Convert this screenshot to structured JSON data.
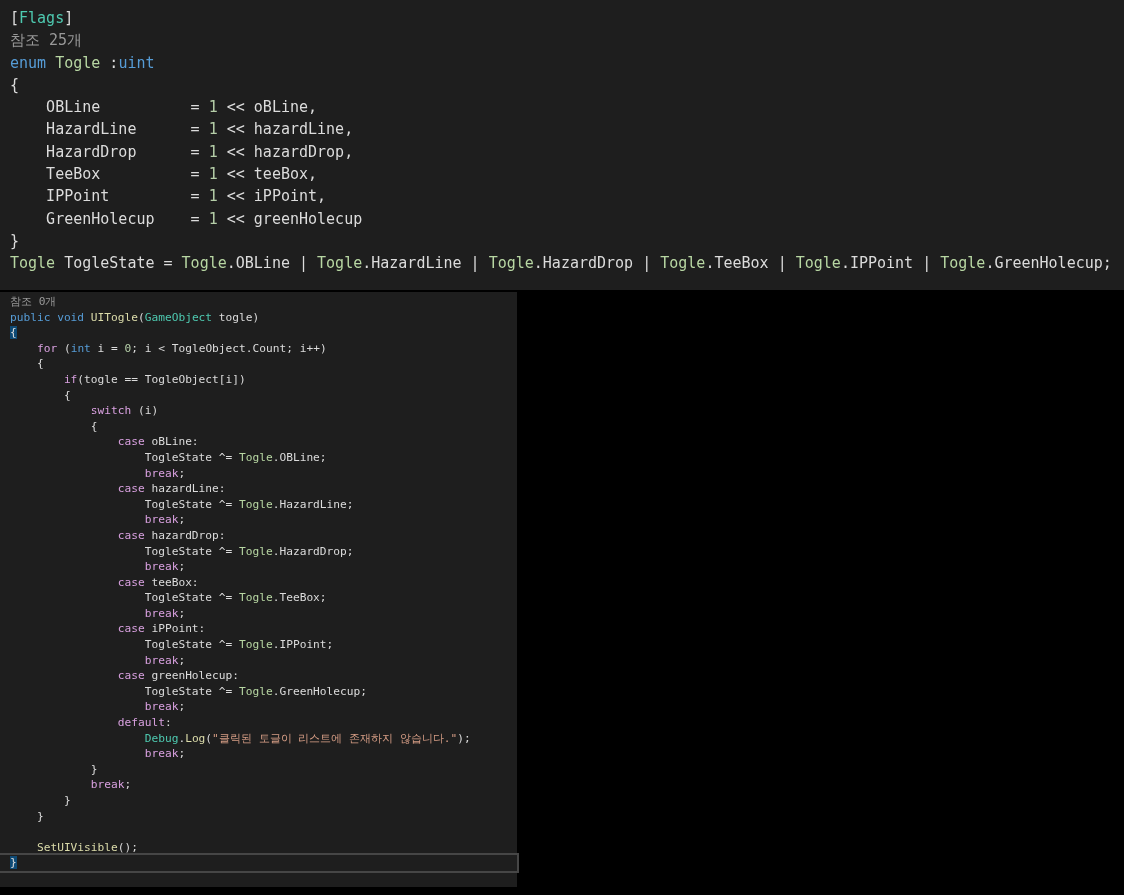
{
  "panels": [
    {
      "kind": "large",
      "lines": [
        {
          "current": false,
          "tokens": [
            {
              "kind": "plain",
              "text": "["
            },
            {
              "kind": "type",
              "text": "Flags"
            },
            {
              "kind": "plain",
              "text": "]"
            }
          ]
        },
        {
          "current": false,
          "tokens": [
            {
              "kind": "lens",
              "text": "참조 25개"
            }
          ]
        },
        {
          "current": false,
          "tokens": [
            {
              "kind": "keyword",
              "text": "enum "
            },
            {
              "kind": "enumtype",
              "text": "Togle"
            },
            {
              "kind": "plain",
              "text": " :"
            },
            {
              "kind": "keyword",
              "text": "uint"
            }
          ]
        },
        {
          "current": false,
          "tokens": [
            {
              "kind": "plain",
              "text": "{"
            }
          ]
        },
        {
          "current": false,
          "tokens": [
            {
              "kind": "plain",
              "text": "    OBLine          = "
            },
            {
              "kind": "number",
              "text": "1"
            },
            {
              "kind": "plain",
              "text": " << oBLine,"
            }
          ]
        },
        {
          "current": false,
          "tokens": [
            {
              "kind": "plain",
              "text": "    HazardLine      = "
            },
            {
              "kind": "number",
              "text": "1"
            },
            {
              "kind": "plain",
              "text": " << hazardLine,"
            }
          ]
        },
        {
          "current": false,
          "tokens": [
            {
              "kind": "plain",
              "text": "    HazardDrop      = "
            },
            {
              "kind": "number",
              "text": "1"
            },
            {
              "kind": "plain",
              "text": " << hazardDrop,"
            }
          ]
        },
        {
          "current": false,
          "tokens": [
            {
              "kind": "plain",
              "text": "    TeeBox          = "
            },
            {
              "kind": "number",
              "text": "1"
            },
            {
              "kind": "plain",
              "text": " << teeBox,"
            }
          ]
        },
        {
          "current": false,
          "tokens": [
            {
              "kind": "plain",
              "text": "    IPPoint         = "
            },
            {
              "kind": "number",
              "text": "1"
            },
            {
              "kind": "plain",
              "text": " << iPPoint,"
            }
          ]
        },
        {
          "current": false,
          "tokens": [
            {
              "kind": "plain",
              "text": "    GreenHolecup    = "
            },
            {
              "kind": "number",
              "text": "1"
            },
            {
              "kind": "plain",
              "text": " << greenHolecup"
            }
          ]
        },
        {
          "current": false,
          "tokens": [
            {
              "kind": "plain",
              "text": "}"
            }
          ]
        },
        {
          "current": false,
          "tokens": [
            {
              "kind": "enumtype",
              "text": "Togle"
            },
            {
              "kind": "plain",
              "text": " TogleState = "
            },
            {
              "kind": "enumtype",
              "text": "Togle"
            },
            {
              "kind": "plain",
              "text": ".OBLine | "
            },
            {
              "kind": "enumtype",
              "text": "Togle"
            },
            {
              "kind": "plain",
              "text": ".HazardLine | "
            },
            {
              "kind": "enumtype",
              "text": "Togle"
            },
            {
              "kind": "plain",
              "text": ".HazardDrop | "
            },
            {
              "kind": "enumtype",
              "text": "Togle"
            },
            {
              "kind": "plain",
              "text": ".TeeBox | "
            },
            {
              "kind": "enumtype",
              "text": "Togle"
            },
            {
              "kind": "plain",
              "text": ".IPPoint | "
            },
            {
              "kind": "enumtype",
              "text": "Togle"
            },
            {
              "kind": "plain",
              "text": ".GreenHolecup;"
            }
          ]
        }
      ]
    },
    {
      "kind": "small",
      "lines": [
        {
          "current": false,
          "tokens": [
            {
              "kind": "lens",
              "text": "참조 0개"
            }
          ]
        },
        {
          "current": false,
          "tokens": [
            {
              "kind": "keyword",
              "text": "public void "
            },
            {
              "kind": "method",
              "text": "UITogle"
            },
            {
              "kind": "plain",
              "text": "("
            },
            {
              "kind": "type",
              "text": "GameObject"
            },
            {
              "kind": "plain",
              "text": " togle)"
            }
          ]
        },
        {
          "current": false,
          "tokens": [
            {
              "kind": "brace_match",
              "text": "{"
            }
          ]
        },
        {
          "current": false,
          "tokens": [
            {
              "kind": "control",
              "text": "    for"
            },
            {
              "kind": "plain",
              "text": " ("
            },
            {
              "kind": "keyword",
              "text": "int"
            },
            {
              "kind": "plain",
              "text": " i = "
            },
            {
              "kind": "number",
              "text": "0"
            },
            {
              "kind": "plain",
              "text": "; i < TogleObject.Count; i++)"
            }
          ]
        },
        {
          "current": false,
          "tokens": [
            {
              "kind": "plain",
              "text": "    {"
            }
          ]
        },
        {
          "current": false,
          "tokens": [
            {
              "kind": "control",
              "text": "        if"
            },
            {
              "kind": "plain",
              "text": "(togle == TogleObject[i])"
            }
          ]
        },
        {
          "current": false,
          "tokens": [
            {
              "kind": "plain",
              "text": "        {"
            }
          ]
        },
        {
          "current": false,
          "tokens": [
            {
              "kind": "control",
              "text": "            switch"
            },
            {
              "kind": "plain",
              "text": " (i)"
            }
          ]
        },
        {
          "current": false,
          "tokens": [
            {
              "kind": "plain",
              "text": "            {"
            }
          ]
        },
        {
          "current": false,
          "tokens": [
            {
              "kind": "control",
              "text": "                case"
            },
            {
              "kind": "plain",
              "text": " oBLine:"
            }
          ]
        },
        {
          "current": false,
          "tokens": [
            {
              "kind": "plain",
              "text": "                    TogleState ^= "
            },
            {
              "kind": "enumtype",
              "text": "Togle"
            },
            {
              "kind": "plain",
              "text": ".OBLine;"
            }
          ]
        },
        {
          "current": false,
          "tokens": [
            {
              "kind": "control",
              "text": "                    break"
            },
            {
              "kind": "plain",
              "text": ";"
            }
          ]
        },
        {
          "current": false,
          "tokens": [
            {
              "kind": "control",
              "text": "                case"
            },
            {
              "kind": "plain",
              "text": " hazardLine:"
            }
          ]
        },
        {
          "current": false,
          "tokens": [
            {
              "kind": "plain",
              "text": "                    TogleState ^= "
            },
            {
              "kind": "enumtype",
              "text": "Togle"
            },
            {
              "kind": "plain",
              "text": ".HazardLine;"
            }
          ]
        },
        {
          "current": false,
          "tokens": [
            {
              "kind": "control",
              "text": "                    break"
            },
            {
              "kind": "plain",
              "text": ";"
            }
          ]
        },
        {
          "current": false,
          "tokens": [
            {
              "kind": "control",
              "text": "                case"
            },
            {
              "kind": "plain",
              "text": " hazardDrop:"
            }
          ]
        },
        {
          "current": false,
          "tokens": [
            {
              "kind": "plain",
              "text": "                    TogleState ^= "
            },
            {
              "kind": "enumtype",
              "text": "Togle"
            },
            {
              "kind": "plain",
              "text": ".HazardDrop;"
            }
          ]
        },
        {
          "current": false,
          "tokens": [
            {
              "kind": "control",
              "text": "                    break"
            },
            {
              "kind": "plain",
              "text": ";"
            }
          ]
        },
        {
          "current": false,
          "tokens": [
            {
              "kind": "control",
              "text": "                case"
            },
            {
              "kind": "plain",
              "text": " teeBox:"
            }
          ]
        },
        {
          "current": false,
          "tokens": [
            {
              "kind": "plain",
              "text": "                    TogleState ^= "
            },
            {
              "kind": "enumtype",
              "text": "Togle"
            },
            {
              "kind": "plain",
              "text": ".TeeBox;"
            }
          ]
        },
        {
          "current": false,
          "tokens": [
            {
              "kind": "control",
              "text": "                    break"
            },
            {
              "kind": "plain",
              "text": ";"
            }
          ]
        },
        {
          "current": false,
          "tokens": [
            {
              "kind": "control",
              "text": "                case"
            },
            {
              "kind": "plain",
              "text": " iPPoint:"
            }
          ]
        },
        {
          "current": false,
          "tokens": [
            {
              "kind": "plain",
              "text": "                    TogleState ^= "
            },
            {
              "kind": "enumtype",
              "text": "Togle"
            },
            {
              "kind": "plain",
              "text": ".IPPoint;"
            }
          ]
        },
        {
          "current": false,
          "tokens": [
            {
              "kind": "control",
              "text": "                    break"
            },
            {
              "kind": "plain",
              "text": ";"
            }
          ]
        },
        {
          "current": false,
          "tokens": [
            {
              "kind": "control",
              "text": "                case"
            },
            {
              "kind": "plain",
              "text": " greenHolecup:"
            }
          ]
        },
        {
          "current": false,
          "tokens": [
            {
              "kind": "plain",
              "text": "                    TogleState ^= "
            },
            {
              "kind": "enumtype",
              "text": "Togle"
            },
            {
              "kind": "plain",
              "text": ".GreenHolecup;"
            }
          ]
        },
        {
          "current": false,
          "tokens": [
            {
              "kind": "control",
              "text": "                    break"
            },
            {
              "kind": "plain",
              "text": ";"
            }
          ]
        },
        {
          "current": false,
          "tokens": [
            {
              "kind": "control",
              "text": "                default"
            },
            {
              "kind": "plain",
              "text": ":"
            }
          ]
        },
        {
          "current": false,
          "tokens": [
            {
              "kind": "type",
              "text": "                    Debug"
            },
            {
              "kind": "plain",
              "text": "."
            },
            {
              "kind": "method",
              "text": "Log"
            },
            {
              "kind": "plain",
              "text": "("
            },
            {
              "kind": "string",
              "text": "\"클릭된 토글이 리스트에 존재하지 않습니다.\""
            },
            {
              "kind": "plain",
              "text": ");"
            }
          ]
        },
        {
          "current": false,
          "tokens": [
            {
              "kind": "control",
              "text": "                    break"
            },
            {
              "kind": "plain",
              "text": ";"
            }
          ]
        },
        {
          "current": false,
          "tokens": [
            {
              "kind": "plain",
              "text": "            }"
            }
          ]
        },
        {
          "current": false,
          "tokens": [
            {
              "kind": "control",
              "text": "            break"
            },
            {
              "kind": "plain",
              "text": ";"
            }
          ]
        },
        {
          "current": false,
          "tokens": [
            {
              "kind": "plain",
              "text": "        }"
            }
          ]
        },
        {
          "current": false,
          "tokens": [
            {
              "kind": "plain",
              "text": "    }"
            }
          ]
        },
        {
          "current": false
        },
        {
          "current": false,
          "tokens": [
            {
              "kind": "method",
              "text": "    SetUIVisible"
            },
            {
              "kind": "plain",
              "text": "();"
            }
          ]
        },
        {
          "current": true,
          "tokens": [
            {
              "kind": "brace_match",
              "text": "}"
            }
          ]
        }
      ]
    }
  ]
}
